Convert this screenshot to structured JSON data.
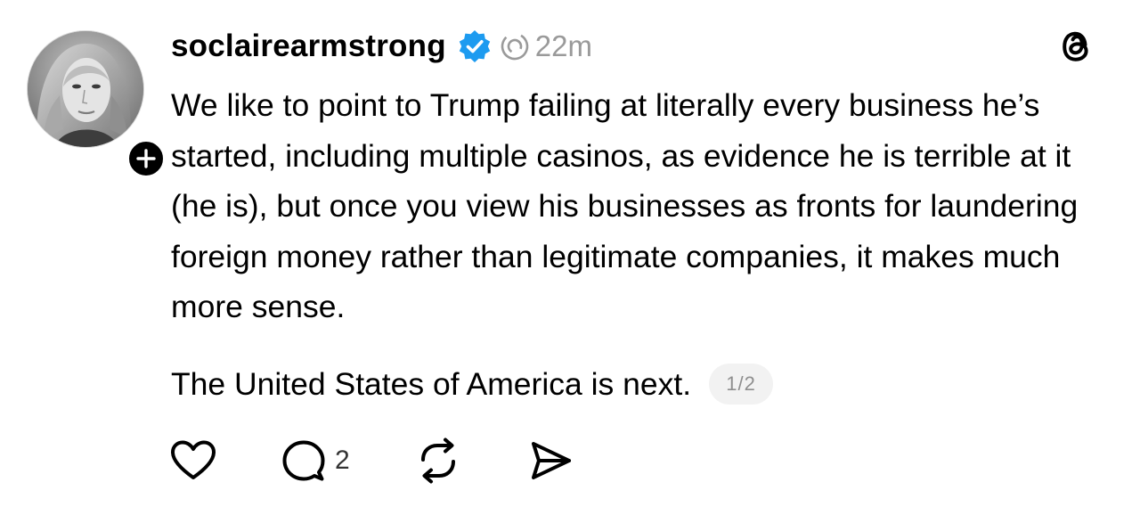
{
  "post": {
    "username": "soclairearmstrong",
    "timestamp": "22m",
    "text": "We like to point to Trump failing at literally every business he’s started, including multiple casinos, as evidence he is terrible at it (he is), but once you view his businesses as fronts for laundering foreign money rather than legitimate companies, it makes much more sense.",
    "text_second": "The United States of America is next.",
    "thread_counter": "1/2",
    "reply_count": "2"
  },
  "icons": {
    "verified": "verified-badge-icon",
    "activity": "activity-ring-icon",
    "logo": "threads-logo-icon",
    "follow": "plus-icon",
    "like": "heart-icon",
    "reply": "speech-bubble-icon",
    "repost": "repost-icon",
    "share": "send-icon"
  },
  "colors": {
    "verified_blue": "#1d9bf0",
    "timestamp_gray": "#9a9a9a",
    "counter_bg": "#f2f2f2"
  }
}
